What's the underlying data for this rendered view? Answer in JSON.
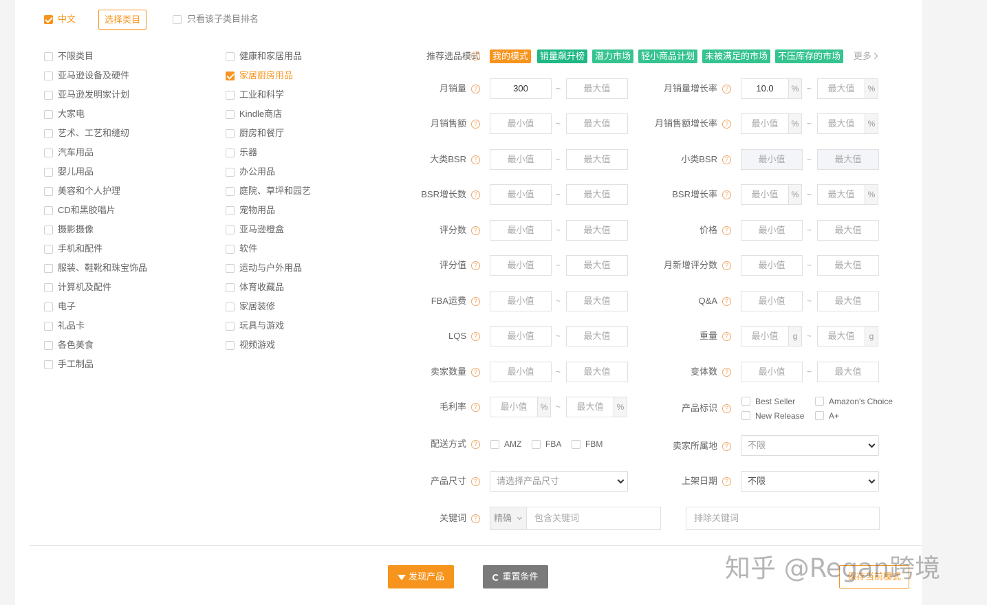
{
  "top": {
    "lang_label": "中文",
    "select_category_button": "选择类目",
    "only_subcategory_label": "只看该子类目排名"
  },
  "categories": {
    "col1": [
      "不限类目",
      "亚马逊设备及硬件",
      "亚马逊发明家计划",
      "大家电",
      "艺术、工艺和缝纫",
      "汽车用品",
      "婴儿用品",
      "美容和个人护理",
      "CD和黑胶唱片",
      "摄影摄像",
      "手机和配件",
      "服装、鞋靴和珠宝饰品",
      "计算机及配件",
      "电子",
      "礼品卡",
      "各色美食",
      "手工制品"
    ],
    "col2": [
      "健康和家居用品",
      "家居厨房用品",
      "工业和科学",
      "Kindle商店",
      "厨房和餐厅",
      "乐器",
      "办公用品",
      "庭院、草坪和园艺",
      "宠物用品",
      "亚马逊橙盒",
      "软件",
      "运动与户外用品",
      "体育收藏品",
      "家居装修",
      "玩具与游戏",
      "视频游戏"
    ],
    "checked": "家居厨房用品"
  },
  "modes": {
    "label": "推荐选品模式",
    "tags": [
      "我的模式",
      "销量飙升榜",
      "潜力市场",
      "轻小商品计划",
      "未被满足的市场",
      "不压库存的市场"
    ],
    "more": "更多"
  },
  "placeholders": {
    "min": "最小值",
    "max": "最大值"
  },
  "units": {
    "percent": "%",
    "gram": "g"
  },
  "tilde": "~",
  "filters": {
    "monthly_sales": {
      "label": "月销量",
      "min_value": "300"
    },
    "monthly_sales_growth": {
      "label": "月销量增长率",
      "min_value": "10.0"
    },
    "monthly_revenue": {
      "label": "月销售额"
    },
    "monthly_revenue_growth": {
      "label": "月销售额增长率"
    },
    "main_bsr": {
      "label": "大类BSR"
    },
    "sub_bsr": {
      "label": "小类BSR"
    },
    "bsr_growth_count": {
      "label": "BSR增长数"
    },
    "bsr_growth_rate": {
      "label": "BSR增长率"
    },
    "rating_count": {
      "label": "评分数"
    },
    "price": {
      "label": "价格"
    },
    "rating_value": {
      "label": "评分值"
    },
    "monthly_new_ratings": {
      "label": "月新增评分数"
    },
    "fba_fee": {
      "label": "FBA运费"
    },
    "qa": {
      "label": "Q&A"
    },
    "lqs": {
      "label": "LQS"
    },
    "weight": {
      "label": "重量"
    },
    "seller_count": {
      "label": "卖家数量"
    },
    "variants": {
      "label": "变体数"
    },
    "gross_margin": {
      "label": "毛利率"
    },
    "product_badge": {
      "label": "产品标识",
      "options": [
        "Best Seller",
        "Amazon's Choice",
        "New Release",
        "A+"
      ]
    },
    "shipping": {
      "label": "配送方式",
      "options": [
        "AMZ",
        "FBA",
        "FBM"
      ]
    },
    "seller_location": {
      "label": "卖家所属地",
      "value": "不限"
    },
    "product_size": {
      "label": "产品尺寸",
      "value": "请选择产品尺寸"
    },
    "listing_date": {
      "label": "上架日期",
      "value": "不限"
    },
    "keyword": {
      "label": "关键词",
      "mode": "精确",
      "include_placeholder": "包含关键词",
      "exclude_placeholder": "排除关键词"
    }
  },
  "buttons": {
    "discover": "发现产品",
    "reset": "重置条件",
    "save": "保存当前模式"
  },
  "watermark": "知乎 @Regan跨境",
  "help_glyph": "?",
  "colors": {
    "accent": "#f7941d",
    "green": "#1fb885",
    "gray_button": "#7a7a7a"
  }
}
